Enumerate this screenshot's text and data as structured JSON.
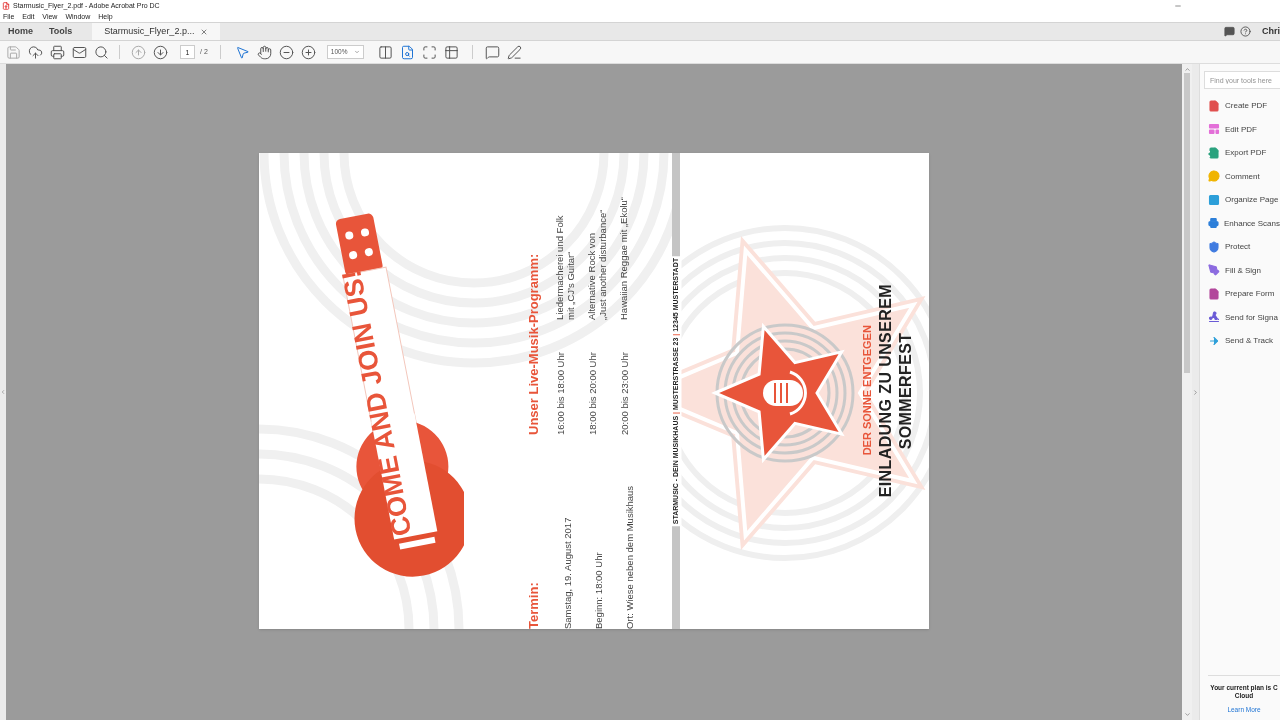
{
  "window": {
    "title": "Starmusic_Flyer_2.pdf - Adobe Acrobat Pro DC"
  },
  "menu": [
    "File",
    "Edit",
    "View",
    "Window",
    "Help"
  ],
  "nav_tabs": [
    {
      "label": "Home",
      "selected": false
    },
    {
      "label": "Tools",
      "selected": false
    },
    {
      "label": "Starmusic_Flyer_2.p...",
      "selected": true,
      "closable": true
    }
  ],
  "user": "Chri",
  "toolbar": {
    "page": "1",
    "page_total": "/ 2",
    "zoom": "100%"
  },
  "flyer": {
    "headline": "COME AND JOIN US!",
    "date_heading": "Termin:",
    "date_lines": [
      "Samstag, 19. August 2017",
      "Beginn: 18:00 Uhr",
      "Ort: Wiese neben dem Musikhaus"
    ],
    "program_heading": "Unser Live-Musik-Programm:",
    "program": [
      {
        "time": "16:00 bis 18:00 Uhr",
        "act_lines": [
          "Liedermacherei und Folk",
          "mit „CJ’s Guitar“"
        ]
      },
      {
        "time": "18:00 bis 20:00 Uhr",
        "act_lines": [
          "Alternative Rock von",
          "„Just another disturbance“"
        ]
      },
      {
        "time": "20:00 bis 23:00 Uhr",
        "act_lines": [
          "Hawaiian Reggae mit „Ekolu“"
        ]
      }
    ],
    "spine": {
      "parts": [
        "STARMUSIC - DEIN MUSIKHAUS",
        "MUSTERSTRASSE 23",
        "12345 MUSTERSTADT"
      ],
      "separator": "|"
    },
    "tagline": "DER SONNE ENTGEGEN",
    "title_lines": [
      "EINLADUNG ZU UNSEREM",
      "SOMMERFEST"
    ]
  },
  "tools_panel": {
    "search_placeholder": "Find your tools here",
    "tools": [
      {
        "label": "Create PDF",
        "color": "#e0504f"
      },
      {
        "label": "Edit PDF",
        "color": "#e36fd8"
      },
      {
        "label": "Export PDF",
        "color": "#2aa27e"
      },
      {
        "label": "Comment",
        "color": "#f0b400"
      },
      {
        "label": "Organize Page",
        "color": "#2d9fd9"
      },
      {
        "label": "Enhance Scans",
        "color": "#2d7fd9"
      },
      {
        "label": "Protect",
        "color": "#3f7be0"
      },
      {
        "label": "Fill & Sign",
        "color": "#8c6be0"
      },
      {
        "label": "Prepare Form",
        "color": "#b2479b"
      },
      {
        "label": "Send for Signa",
        "color": "#6a5bd6"
      },
      {
        "label": "Send & Track",
        "color": "#2d9fd9"
      }
    ],
    "plan_lines": [
      "Your current plan is C",
      "Cloud"
    ],
    "link": "Learn More"
  }
}
